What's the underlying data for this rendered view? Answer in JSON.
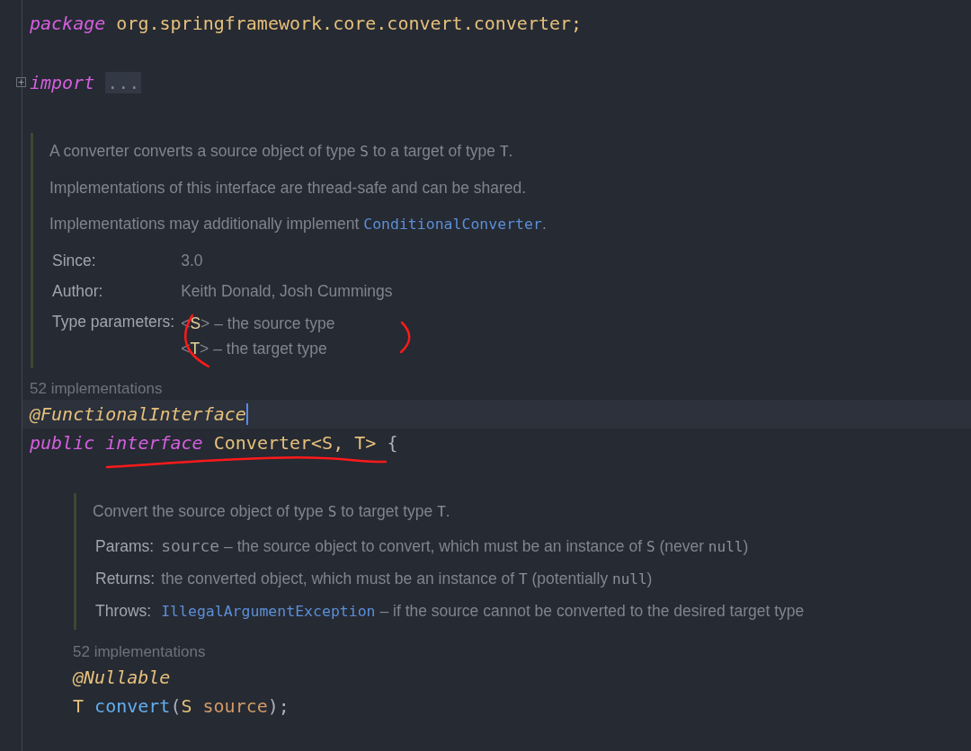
{
  "editor": {
    "lines": [
      {
        "kind": "code",
        "tokens": [
          {
            "kind": "keyword",
            "text": "package"
          },
          {
            "kind": "plain",
            "text": " org.springframework.core.convert.converter;"
          }
        ]
      },
      {
        "kind": "blank"
      },
      {
        "kind": "code",
        "folded": true,
        "tokens": [
          {
            "kind": "keyword",
            "text": "import"
          },
          {
            "kind": "fold",
            "text": "..."
          }
        ]
      },
      {
        "kind": "blank"
      },
      {
        "kind": "doc",
        "paragraphs": [
          [
            {
              "kind": "text",
              "text": "A converter converts a source object of type "
            },
            {
              "kind": "code",
              "text": "S"
            },
            {
              "kind": "text",
              "text": " to a target of type "
            },
            {
              "kind": "code",
              "text": "T"
            },
            {
              "kind": "text",
              "text": "."
            }
          ],
          [
            {
              "kind": "text",
              "text": "Implementations of this interface are thread-safe and can be shared."
            }
          ],
          [
            {
              "kind": "text",
              "text": "Implementations may additionally implement "
            },
            {
              "kind": "link",
              "text": "ConditionalConverter"
            },
            {
              "kind": "text",
              "text": "."
            }
          ]
        ],
        "tags": [
          {
            "label": "Since:",
            "values": [
              [
                {
                  "kind": "text",
                  "text": "3.0"
                }
              ]
            ]
          },
          {
            "label": "Author:",
            "values": [
              [
                {
                  "kind": "text",
                  "text": "Keith Donald, Josh Cummings"
                }
              ]
            ]
          },
          {
            "label": "Type parameters:",
            "values": [
              [
                {
                  "kind": "text",
                  "text": "<"
                },
                {
                  "kind": "typevar",
                  "text": "S"
                },
                {
                  "kind": "text",
                  "text": "> – the source type"
                }
              ],
              [
                {
                  "kind": "text",
                  "text": "<"
                },
                {
                  "kind": "typevar",
                  "text": "T"
                },
                {
                  "kind": "text",
                  "text": "> – the target type"
                }
              ]
            ]
          }
        ]
      },
      {
        "kind": "hint",
        "text": "52 implementations"
      },
      {
        "kind": "code",
        "current": true,
        "caret": true,
        "tokens": [
          {
            "kind": "annotation",
            "text": "@FunctionalInterface"
          }
        ]
      },
      {
        "kind": "code",
        "tokens": [
          {
            "kind": "keyword",
            "text": "public"
          },
          {
            "kind": "keyword",
            "text": " interface"
          },
          {
            "kind": "plain",
            "text": " Converter<S, T> "
          },
          {
            "kind": "punct",
            "text": "{"
          }
        ],
        "body": [
          {
            "kind": "blank"
          },
          {
            "kind": "doc",
            "paragraphs": [
              [
                {
                  "kind": "text",
                  "text": "Convert the source object of type "
                },
                {
                  "kind": "code",
                  "text": "S"
                },
                {
                  "kind": "text",
                  "text": " to target type "
                },
                {
                  "kind": "code",
                  "text": "T"
                },
                {
                  "kind": "text",
                  "text": "."
                }
              ]
            ],
            "tags": [
              {
                "label": "Params:",
                "values": [
                  [
                    {
                      "kind": "param",
                      "text": "source"
                    },
                    {
                      "kind": "text",
                      "text": " – the source object to convert, which must be an instance of "
                    },
                    {
                      "kind": "code",
                      "text": "S"
                    },
                    {
                      "kind": "text",
                      "text": " (never "
                    },
                    {
                      "kind": "code",
                      "text": "null"
                    },
                    {
                      "kind": "text",
                      "text": ")"
                    }
                  ]
                ]
              },
              {
                "label": "Returns:",
                "values": [
                  [
                    {
                      "kind": "text",
                      "text": "the converted object, which must be an instance of "
                    },
                    {
                      "kind": "code",
                      "text": "T"
                    },
                    {
                      "kind": "text",
                      "text": " (potentially "
                    },
                    {
                      "kind": "code",
                      "text": "null"
                    },
                    {
                      "kind": "text",
                      "text": ")"
                    }
                  ]
                ]
              },
              {
                "label": "Throws:",
                "values": [
                  [
                    {
                      "kind": "link",
                      "text": "IllegalArgumentException"
                    },
                    {
                      "kind": "text",
                      "text": " – if the source cannot be converted to the desired target type"
                    }
                  ]
                ]
              }
            ]
          },
          {
            "kind": "hint",
            "text": "52 implementations"
          },
          {
            "kind": "code",
            "tokens": [
              {
                "kind": "annotation",
                "text": "@Nullable"
              }
            ]
          },
          {
            "kind": "code",
            "tokens": [
              {
                "kind": "plain",
                "text": "T "
              },
              {
                "kind": "function",
                "text": "convert"
              },
              {
                "kind": "punct",
                "text": "("
              },
              {
                "kind": "plain",
                "text": "S "
              },
              {
                "kind": "param",
                "text": "source"
              },
              {
                "kind": "punct",
                "text": ");"
              }
            ]
          }
        ]
      }
    ]
  }
}
